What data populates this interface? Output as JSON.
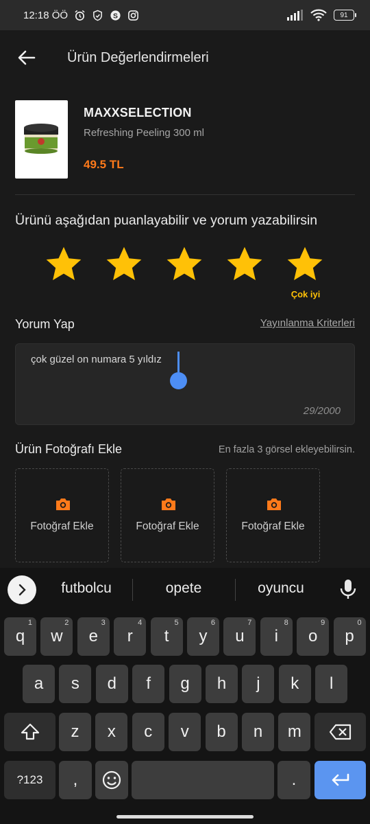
{
  "status_bar": {
    "time": "12:18 ÖÖ",
    "battery": "91"
  },
  "header": {
    "title": "Ürün Değerlendirmeleri"
  },
  "product": {
    "brand": "MAXXSELECTION",
    "name": "Refreshing Peeling 300 ml",
    "price": "49.5 TL"
  },
  "rating": {
    "prompt": "Ürünü aşağıdan puanlayabilir ve yorum yazabilirsin",
    "stars_selected": 5,
    "stars_total": 5,
    "label": "Çok iyi",
    "star_color": "#FFC107"
  },
  "comment": {
    "title": "Yorum Yap",
    "criteria_link": "Yayınlanma Kriterleri",
    "text": "çok güzel on numara 5 yıldız",
    "counter": "29/2000"
  },
  "photos": {
    "title": "Ürün Fotoğrafı Ekle",
    "limit_text": "En fazla 3 görsel ekleyebilirsin.",
    "slots": [
      {
        "label": "Fotoğraf Ekle",
        "icon": "camera-icon"
      },
      {
        "label": "Fotoğraf Ekle",
        "icon": "camera-icon"
      },
      {
        "label": "Fotoğraf Ekle",
        "icon": "camera-icon"
      }
    ]
  },
  "keyboard": {
    "suggestions": [
      "futbolcu",
      "opete",
      "oyuncu"
    ],
    "row1": [
      {
        "k": "q",
        "s": "1"
      },
      {
        "k": "w",
        "s": "2"
      },
      {
        "k": "e",
        "s": "3"
      },
      {
        "k": "r",
        "s": "4"
      },
      {
        "k": "t",
        "s": "5"
      },
      {
        "k": "y",
        "s": "6"
      },
      {
        "k": "u",
        "s": "7"
      },
      {
        "k": "i",
        "s": "8"
      },
      {
        "k": "o",
        "s": "9"
      },
      {
        "k": "p",
        "s": "0"
      }
    ],
    "row2": [
      "a",
      "s",
      "d",
      "f",
      "g",
      "h",
      "j",
      "k",
      "l"
    ],
    "row3": [
      "z",
      "x",
      "c",
      "v",
      "b",
      "n",
      "m"
    ],
    "symbols_key": "?123",
    "comma_key": ",",
    "period_key": "."
  },
  "colors": {
    "accent_orange": "#FF7A1A",
    "keyboard_enter": "#5B95F0",
    "cursor_blue": "#4D8EF5"
  }
}
